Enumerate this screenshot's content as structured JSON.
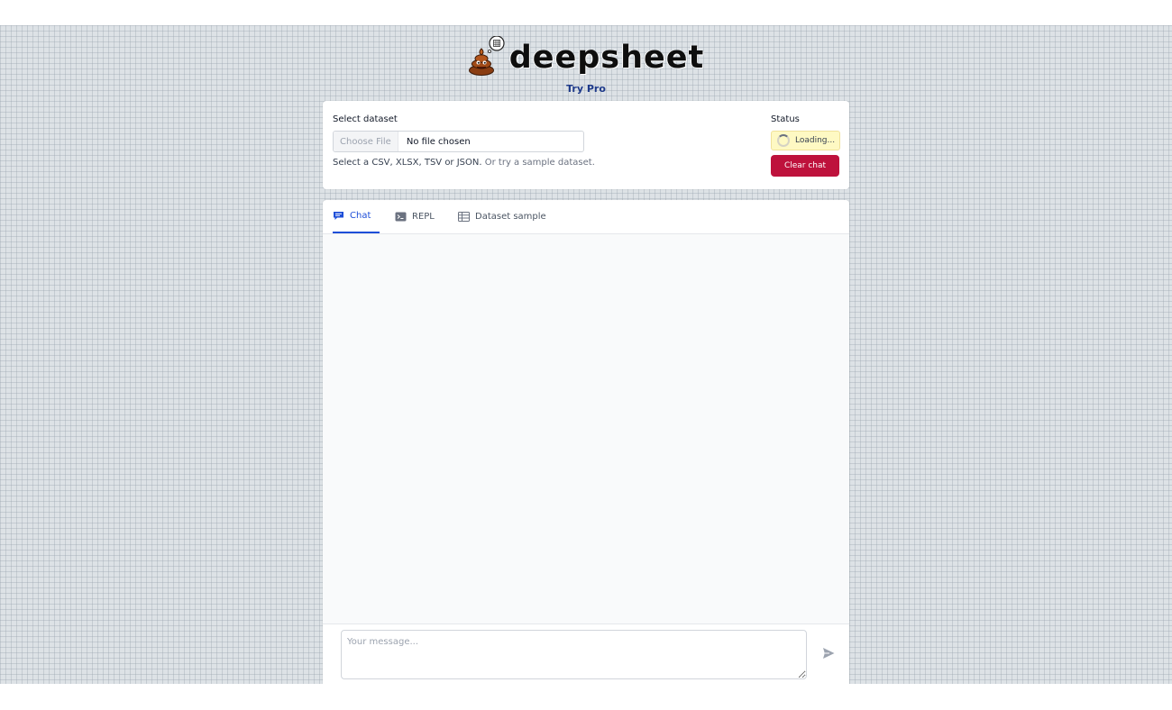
{
  "header": {
    "logo_text": "deepsheet",
    "try_pro": "Try Pro"
  },
  "dataset": {
    "label": "Select dataset",
    "choose_file_button": "Choose File",
    "file_status": "No file chosen",
    "help_text": "Select a CSV, XLSX, TSV or JSON.",
    "sample_link": "Or try a sample dataset."
  },
  "status": {
    "label": "Status",
    "value": "Loading...",
    "clear_button": "Clear chat"
  },
  "tabs": [
    {
      "label": "Chat",
      "icon": "chat-bubble-icon",
      "active": true
    },
    {
      "label": "REPL",
      "icon": "terminal-icon",
      "active": false
    },
    {
      "label": "Dataset sample",
      "icon": "table-icon",
      "active": false
    }
  ],
  "composer": {
    "placeholder": "Your message...",
    "send_icon": "send-icon"
  },
  "colors": {
    "accent": "#1d4ed8",
    "danger": "#be123c",
    "status_bg": "#fef9c3",
    "try_pro": "#1e3a8a"
  }
}
